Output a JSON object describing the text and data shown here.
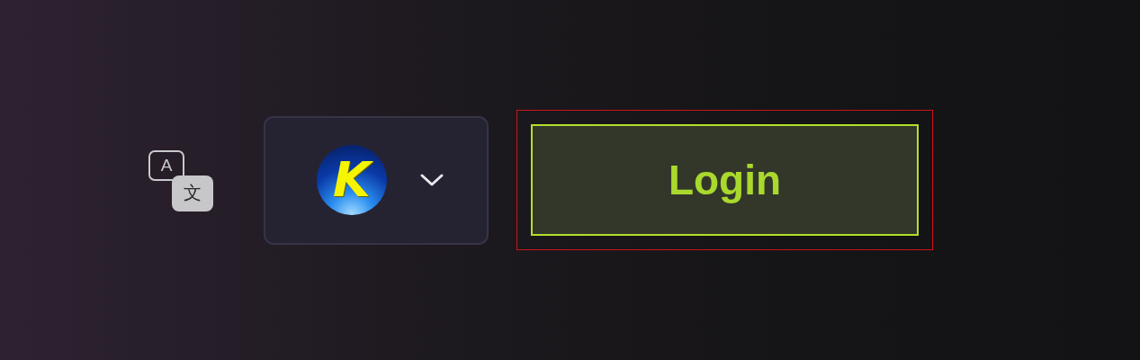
{
  "language_icon": {
    "latin": "A",
    "cjk": "文"
  },
  "account_selector": {
    "logo_letter": "K",
    "expanded": false
  },
  "login_button": {
    "label": "Login",
    "focused": true
  }
}
